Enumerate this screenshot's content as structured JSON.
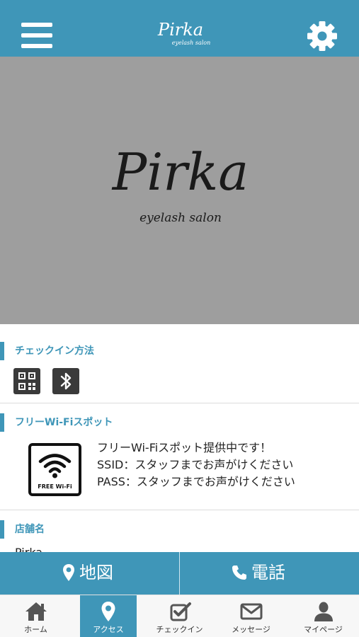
{
  "header": {
    "brand": "Pirka",
    "brand_sub": "eyelash salon",
    "menu_icon": "hamburger-icon",
    "settings_icon": "gear-icon"
  },
  "hero": {
    "brand": "Pirka",
    "sub": "eyelash salon"
  },
  "sections": {
    "checkin": {
      "title": "チェックイン方法",
      "methods": [
        "qr-code-icon",
        "bluetooth-icon"
      ]
    },
    "wifi": {
      "title": "フリーWi-Fiスポット",
      "sign_label": "FREE Wi-Fi",
      "lines": [
        "フリーWi-Fiスポット提供中です！",
        "SSID：スタッフまでお声がけください",
        "PASS：スタッフまでお声がけください"
      ]
    },
    "store": {
      "title": "店舗名",
      "name": "Pirka"
    }
  },
  "actions": {
    "map_label": "地図",
    "phone_label": "電話"
  },
  "tabs": [
    {
      "label": "ホーム",
      "icon": "home-icon",
      "active": false
    },
    {
      "label": "アクセス",
      "icon": "map-pin-icon",
      "active": true
    },
    {
      "label": "チェックイン",
      "icon": "checkin-icon",
      "active": false
    },
    {
      "label": "メッセージ",
      "icon": "envelope-icon",
      "active": false
    },
    {
      "label": "マイページ",
      "icon": "user-icon",
      "active": false
    }
  ],
  "colors": {
    "accent": "#3f96b8",
    "hero_bg": "#9e9e9e",
    "icon_dark": "#3a3a3a"
  }
}
